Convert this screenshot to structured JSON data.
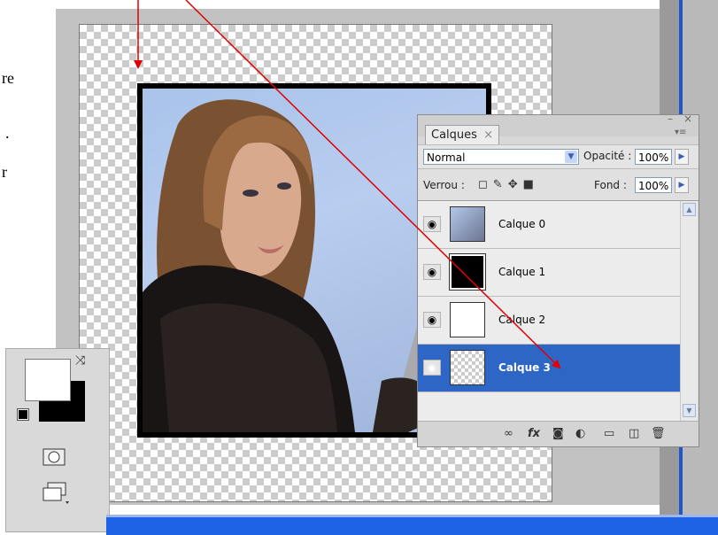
{
  "side_text": {
    "line1": "re",
    "line2": ".",
    "line3": "r"
  },
  "layers_panel": {
    "tab_label": "Calques",
    "tab_close": "×",
    "minimize": "–",
    "close": "×",
    "menu": "▾≡",
    "blend_mode": "Normal",
    "opacity_label": "Opacité :",
    "opacity_value": "100%",
    "lock_label": "Verrou :",
    "fill_label": "Fond :",
    "fill_value": "100%",
    "layers": [
      {
        "name": "Calque 0",
        "thumb": "photo",
        "visible": true,
        "selected": false
      },
      {
        "name": "Calque 1",
        "thumb": "black",
        "visible": true,
        "selected": false
      },
      {
        "name": "Calque 2",
        "thumb": "white",
        "visible": true,
        "selected": false
      },
      {
        "name": "Calque 3",
        "thumb": "checker",
        "visible": true,
        "selected": true
      }
    ],
    "footer_icons": [
      "link-icon",
      "fx-icon",
      "mask-icon",
      "adjustment-icon",
      "folder-icon",
      "new-layer-icon",
      "trash-icon"
    ]
  },
  "colors": {
    "selection": "#2e66c6",
    "annotation_arrow": "#e00000",
    "taskbar": "#1d63e4"
  }
}
